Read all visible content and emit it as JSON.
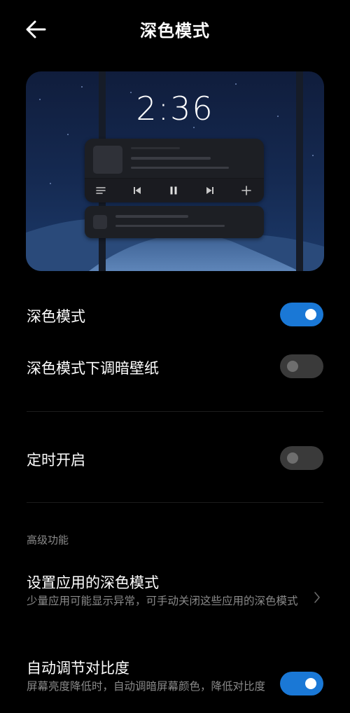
{
  "header": {
    "title": "深色模式",
    "back_icon": "arrow-left-icon"
  },
  "preview": {
    "clock": "2:36",
    "controls": [
      "playlist-icon",
      "previous-icon",
      "pause-icon",
      "next-icon",
      "add-icon"
    ]
  },
  "settings": {
    "dark_mode": {
      "label": "深色模式",
      "enabled": true
    },
    "dim_wallpaper": {
      "label": "深色模式下调暗壁纸",
      "enabled": false
    },
    "scheduled": {
      "label": "定时开启",
      "enabled": false
    }
  },
  "advanced": {
    "section_title": "高级功能",
    "app_dark_mode": {
      "label": "设置应用的深色模式",
      "description": "少量应用可能显示异常，可手动关闭这些应用的深色模式"
    },
    "auto_contrast": {
      "label": "自动调节对比度",
      "description": "屏幕亮度降低时，自动调暗屏幕颜色，降低对比度",
      "enabled": true
    }
  },
  "colors": {
    "accent": "#1a78d6",
    "background": "#000000",
    "secondary_text": "#8a8a8a",
    "toggle_off": "#3a3a3a"
  }
}
